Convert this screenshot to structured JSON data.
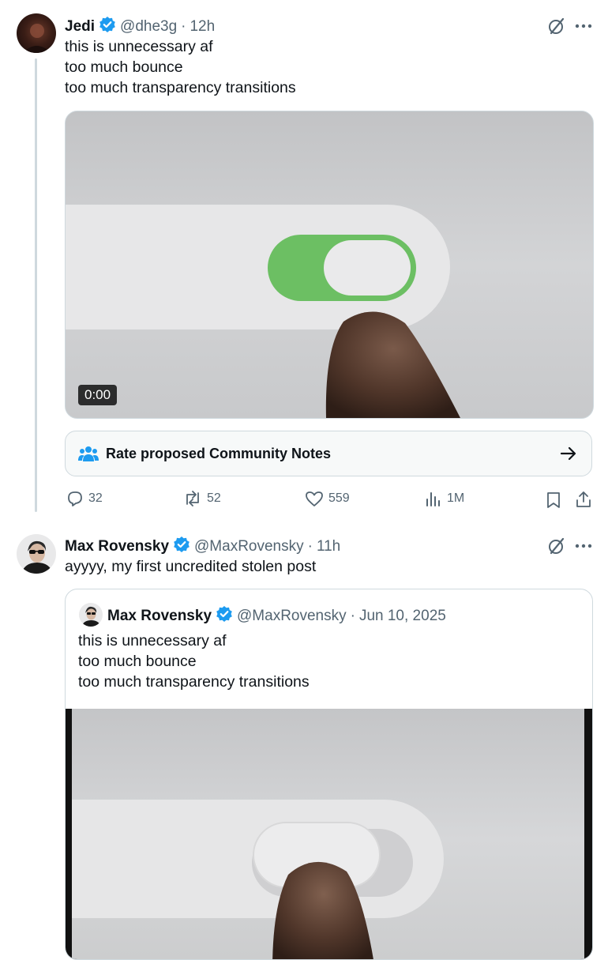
{
  "tweet1": {
    "name": "Jedi",
    "handle": "@dhe3g",
    "sep": "·",
    "time": "12h",
    "lines": [
      "this is unnecessary af",
      "too much bounce",
      "too much transparency transitions"
    ],
    "video_timer": "0:00",
    "notes_label": "Rate proposed Community Notes",
    "replies": "32",
    "reposts": "52",
    "likes": "559",
    "views": "1M"
  },
  "tweet2": {
    "name": "Max Rovensky",
    "handle": "@MaxRovensky",
    "sep": "·",
    "time": "11h",
    "text": "ayyyy, my first uncredited stolen post"
  },
  "quote": {
    "name": "Max Rovensky",
    "handle": "@MaxRovensky",
    "sep": "·",
    "date": "Jun 10, 2025",
    "lines": [
      "this is unnecessary af",
      "too much bounce",
      "too much transparency transitions"
    ]
  },
  "icons": {
    "verified": "verified-badge-icon",
    "grok": "grok-icon",
    "more": "more-icon",
    "community": "community-notes-icon",
    "arrow": "arrow-right-icon",
    "reply": "reply-icon",
    "repost": "repost-icon",
    "like": "heart-icon",
    "views": "views-icon",
    "bookmark": "bookmark-icon",
    "share": "share-icon"
  },
  "colors": {
    "verified": "#1d9bf0",
    "toggle_on": "#6cbf63",
    "secondary_text": "#536471",
    "border": "#cfd9de"
  }
}
